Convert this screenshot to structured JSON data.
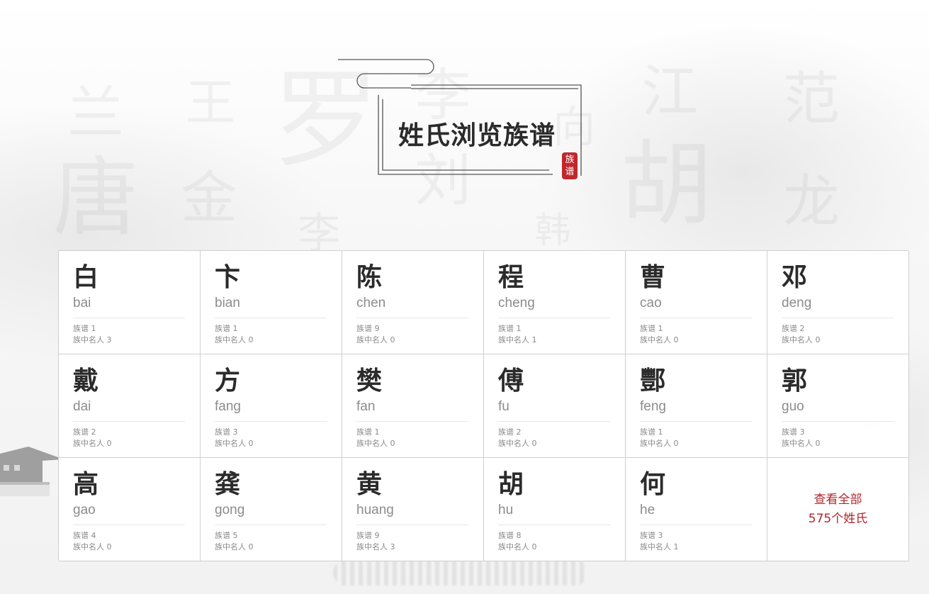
{
  "page_title": "姓氏浏览族谱",
  "seal_text": "族谱",
  "background_chars": [
    "兰",
    "王",
    "罗",
    "李",
    "江",
    "范",
    "唐",
    "金",
    "刘",
    "胡",
    "龙",
    "李",
    "韩",
    "向"
  ],
  "labels": {
    "zupu": "族谱",
    "mingren": "族中名人"
  },
  "surnames": [
    {
      "char": "白",
      "pinyin": "bai",
      "zupu": 1,
      "mingren": 3
    },
    {
      "char": "卞",
      "pinyin": "bian",
      "zupu": 1,
      "mingren": 0
    },
    {
      "char": "陈",
      "pinyin": "chen",
      "zupu": 9,
      "mingren": 0
    },
    {
      "char": "程",
      "pinyin": "cheng",
      "zupu": 1,
      "mingren": 1
    },
    {
      "char": "曹",
      "pinyin": "cao",
      "zupu": 1,
      "mingren": 0
    },
    {
      "char": "邓",
      "pinyin": "deng",
      "zupu": 2,
      "mingren": 0
    },
    {
      "char": "戴",
      "pinyin": "dai",
      "zupu": 2,
      "mingren": 0
    },
    {
      "char": "方",
      "pinyin": "fang",
      "zupu": 3,
      "mingren": 0
    },
    {
      "char": "樊",
      "pinyin": "fan",
      "zupu": 1,
      "mingren": 0
    },
    {
      "char": "傅",
      "pinyin": "fu",
      "zupu": 2,
      "mingren": 0
    },
    {
      "char": "酆",
      "pinyin": "feng",
      "zupu": 1,
      "mingren": 0
    },
    {
      "char": "郭",
      "pinyin": "guo",
      "zupu": 3,
      "mingren": 0
    },
    {
      "char": "高",
      "pinyin": "gao",
      "zupu": 4,
      "mingren": 0
    },
    {
      "char": "龚",
      "pinyin": "gong",
      "zupu": 5,
      "mingren": 0
    },
    {
      "char": "黄",
      "pinyin": "huang",
      "zupu": 9,
      "mingren": 3
    },
    {
      "char": "胡",
      "pinyin": "hu",
      "zupu": 8,
      "mingren": 0
    },
    {
      "char": "何",
      "pinyin": "he",
      "zupu": 3,
      "mingren": 1
    }
  ],
  "view_all": {
    "line1": "查看全部",
    "line2": "575个姓氏"
  },
  "colors": {
    "accent": "#b0262b",
    "seal": "#c0272d",
    "border": "#cfcfcf",
    "text_dark": "#2b2b2b",
    "text_muted": "#8c8c8c"
  }
}
